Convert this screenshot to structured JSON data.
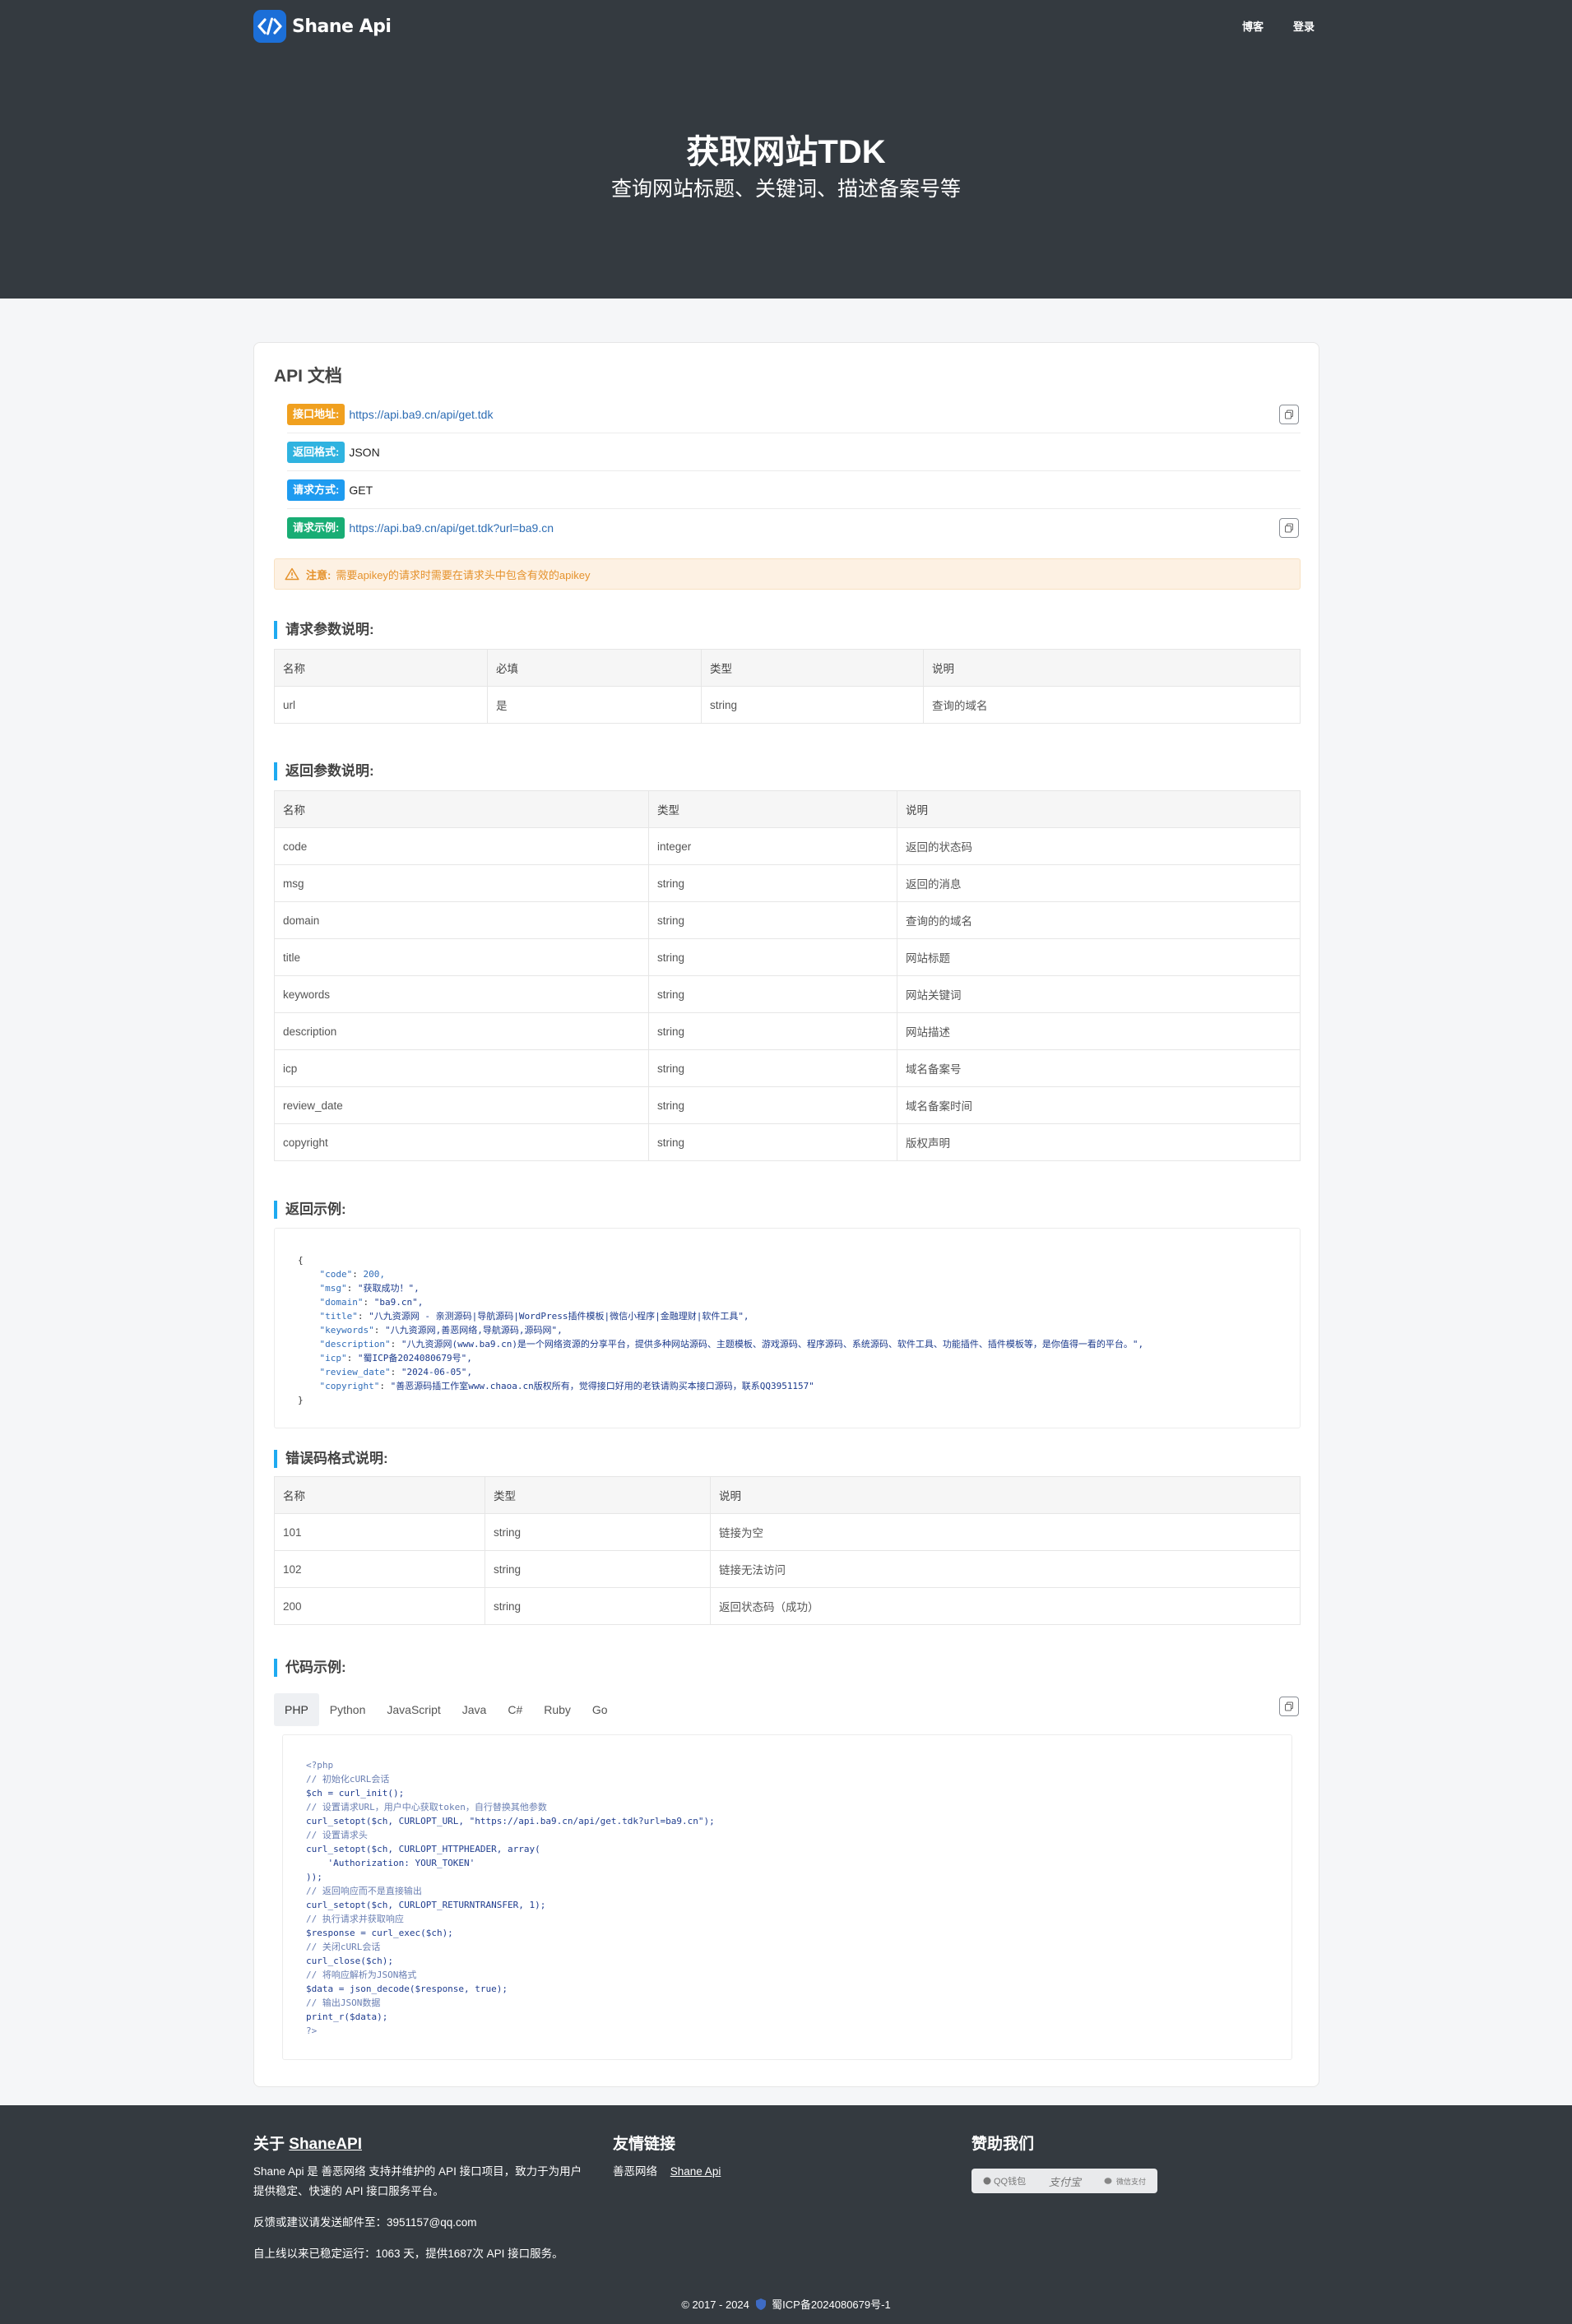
{
  "brand": {
    "name": "Shane Api"
  },
  "nav": {
    "blog": "博客",
    "login": "登录"
  },
  "hero": {
    "title": "获取网站TDK",
    "subtitle": "查询网站标题、关键词、描述备案号等"
  },
  "doc": {
    "title": "API 文档",
    "rows": [
      {
        "label": "接口地址:",
        "value": "https://api.ba9.cn/api/get.tdk",
        "color": "#f0a01f"
      },
      {
        "label": "返回格式:",
        "value": "JSON",
        "color": "#2fb3e0"
      },
      {
        "label": "请求方式:",
        "value": "GET",
        "color": "#1e9bf0"
      },
      {
        "label": "请求示例:",
        "value": "https://api.ba9.cn/api/get.tdk?url=ba9.cn",
        "color": "#18ad74"
      }
    ],
    "notice_label": "注意:",
    "notice_text": "需要apikey的请求时需要在请求头中包含有效的apikey"
  },
  "request_params": {
    "title": "请求参数说明:",
    "headers": [
      "名称",
      "必填",
      "类型",
      "说明"
    ],
    "rows": [
      [
        "url",
        "是",
        "string",
        "查询的域名"
      ]
    ]
  },
  "response_params": {
    "title": "返回参数说明:",
    "headers": [
      "名称",
      "类型",
      "说明"
    ],
    "rows": [
      [
        "code",
        "integer",
        "返回的状态码"
      ],
      [
        "msg",
        "string",
        "返回的消息"
      ],
      [
        "domain",
        "string",
        "查询的的域名"
      ],
      [
        "title",
        "string",
        "网站标题"
      ],
      [
        "keywords",
        "string",
        "网站关键词"
      ],
      [
        "description",
        "string",
        "网站描述"
      ],
      [
        "icp",
        "string",
        "域名备案号"
      ],
      [
        "review_date",
        "string",
        "域名备案时间"
      ],
      [
        "copyright",
        "string",
        "版权声明"
      ]
    ]
  },
  "example": {
    "title": "返回示例:",
    "open": "{",
    "close": "}",
    "lines": [
      {
        "k": "\"code\"",
        "v": "200,"
      },
      {
        "k": "\"msg\"",
        "v": "\"获取成功！\","
      },
      {
        "k": "\"domain\"",
        "v": "\"ba9.cn\","
      },
      {
        "k": "\"title\"",
        "v": "\"八九资源网 - 亲测源码|导航源码|WordPress插件模板|微信小程序|金融理财|软件工具\","
      },
      {
        "k": "\"keywords\"",
        "v": "\"八九资源网,善恶网络,导航源码,源码网\","
      },
      {
        "k": "\"description\"",
        "v": "\"八九资源网(www.ba9.cn)是一个网络资源的分享平台，提供多种网站源码、主题模板、游戏源码、程序源码、系统源码、软件工具、功能插件、插件模板等，是你值得一看的平台。\","
      },
      {
        "k": "\"icp\"",
        "v": "\"蜀ICP备2024080679号\","
      },
      {
        "k": "\"review_date\"",
        "v": "\"2024-06-05\","
      },
      {
        "k": "\"copyright\"",
        "v": "\"善恶源码插工作室www.chaoa.cn版权所有，觉得接口好用的老铁请购买本接口源码，联系QQ3951157\""
      }
    ]
  },
  "error_codes": {
    "title": "错误码格式说明:",
    "headers": [
      "名称",
      "类型",
      "说明"
    ],
    "rows": [
      [
        "101",
        "string",
        "链接为空"
      ],
      [
        "102",
        "string",
        "链接无法访问"
      ],
      [
        "200",
        "string",
        "返回状态码（成功）"
      ]
    ]
  },
  "code_examples": {
    "title": "代码示例:",
    "tabs": [
      "PHP",
      "Python",
      "JavaScript",
      "Java",
      "C#",
      "Ruby",
      "Go"
    ],
    "active": "PHP",
    "php_lines": [
      "<?php",
      "// 初始化cURL会话",
      "$ch = curl_init();",
      "// 设置请求URL，用户中心获取token，自行替换其他参数",
      "curl_setopt($ch, CURLOPT_URL, \"https://api.ba9.cn/api/get.tdk?url=ba9.cn\");",
      "// 设置请求头",
      "curl_setopt($ch, CURLOPT_HTTPHEADER, array(",
      "    'Authorization: YOUR_TOKEN'",
      "));",
      "// 返回响应而不是直接输出",
      "curl_setopt($ch, CURLOPT_RETURNTRANSFER, 1);",
      "// 执行请求并获取响应",
      "$response = curl_exec($ch);",
      "// 关闭cURL会话",
      "curl_close($ch);",
      "// 将响应解析为JSON格式",
      "$data = json_decode($response, true);",
      "// 输出JSON数据",
      "print_r($data);",
      "?>"
    ]
  },
  "footer": {
    "about_title_prefix": "关于 ",
    "about_title_brand": "ShaneAPI",
    "about_text": "Shane Api 是 善恶网络 支持并维护的 API 接口项目，致力于为用户提供稳定、快速的 API 接口服务平台。",
    "feedback": "反馈或建议请发送邮件至：3951157@qq.com",
    "uptime": "自上线以来已稳定运行：1063 天，提供1687次 API 接口服务。",
    "links_title": "友情链接",
    "links": [
      "善恶网络",
      "Shane Api"
    ],
    "sponsor_title": "赞助我们",
    "sponsors": [
      "QQ钱包",
      "支付宝",
      "微信支付"
    ],
    "copyright_prefix": "© 2017 - 2024",
    "icp": "蜀ICP备2024080679号-1"
  }
}
